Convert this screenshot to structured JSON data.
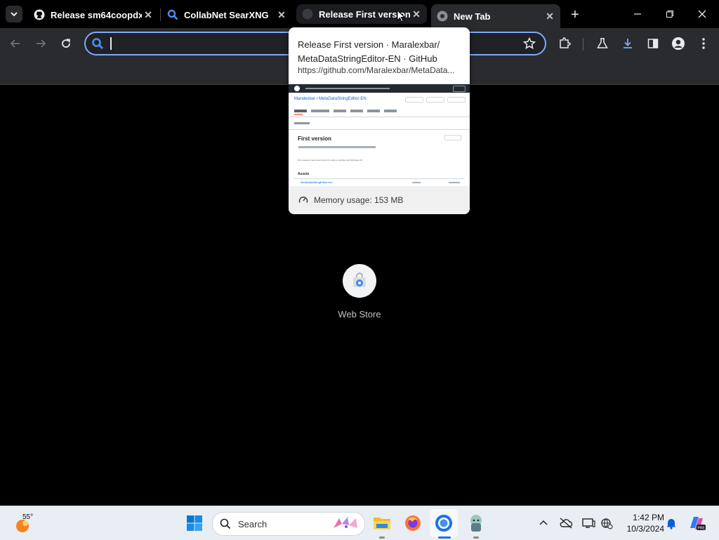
{
  "tabs": [
    {
      "title": "Release sm64coopdx v",
      "icon": "github-icon"
    },
    {
      "title": "CollabNet SearXNG",
      "icon": "search-icon"
    },
    {
      "title": "Release First version",
      "icon": "github-icon"
    },
    {
      "title": "New Tab",
      "icon": "chrome-icon"
    }
  ],
  "omnibox": {
    "value": "",
    "placeholder": ""
  },
  "hovercard": {
    "title": "Release First version · Maralexbar/ MetaDataStringEditor-EN · GitHub",
    "url": "https://github.com/Maralexbar/MetaData...",
    "memory": "Memory usage: 153 MB",
    "preview": {
      "repo": "Maralexbar / MetaDataStringEditor-EN",
      "release_title": "First version",
      "assets_label": "Assets",
      "asset_name": "MetaDataStringEditor.exe",
      "body": "First release if app doesnt work try using a machine with Windows 10"
    }
  },
  "shortcut": {
    "label": "Web Store"
  },
  "taskbar": {
    "weather_temp": "55°",
    "search_label": "Search",
    "time": "1:42 PM",
    "date": "10/3/2024"
  },
  "colors": {
    "accent": "#7cacf8",
    "taskbar_bg": "#e9eef5",
    "active_tab": "#2a2b2e"
  }
}
